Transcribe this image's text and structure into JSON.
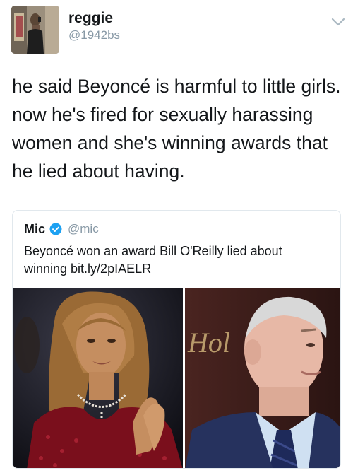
{
  "author": {
    "name": "reggie",
    "handle": "@1942bs",
    "avatar_icon": "profile-photo"
  },
  "menu_icon": "chevron-down-icon",
  "tweet": {
    "lines": [
      "he said Beyoncé is harmful to little girls.",
      "now he's fired for sexually harassing",
      "women and she's winning awards that",
      "he lied about having."
    ]
  },
  "quote": {
    "name": "Mic",
    "handle": "@mic",
    "verified": true,
    "verified_color": "#1da1f2",
    "lines": [
      "Beyoncé won an award Bill O'Reilly lied about",
      "winning bit.ly/2pIAELR"
    ],
    "media": {
      "left_image": "photo-woman-clapping",
      "right_image": "photo-man-in-suit",
      "background_sign_text": "Hol"
    }
  }
}
